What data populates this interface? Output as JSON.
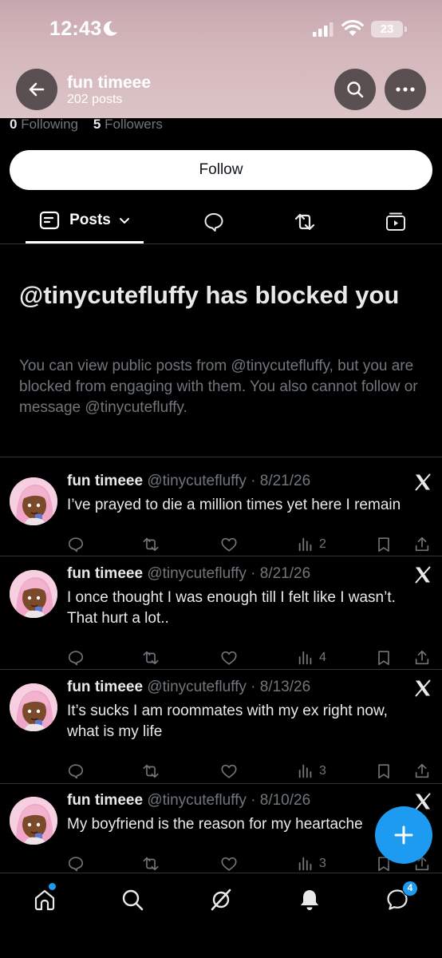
{
  "status_bar": {
    "time": "12:43",
    "battery": "23"
  },
  "header": {
    "name": "fun timeee",
    "posts_count": "202 posts"
  },
  "profile": {
    "following_count": "0",
    "following_label": "Following",
    "followers_count": "5",
    "followers_label": "Followers",
    "follow_button": "Follow"
  },
  "tabs": {
    "active_label": "Posts"
  },
  "blocked": {
    "title": "@tinycutefluffy has blocked you",
    "body": "You can view public posts from @tinycutefluffy, but you are blocked from engaging with them. You also cannot follow or message @tinycutefluffy."
  },
  "posts": [
    {
      "name": "fun timeee",
      "meta": "@tinycutefluffy · 8/21/26",
      "lines": [
        "I’ve prayed to die a million times yet here I remain"
      ],
      "views": "2"
    },
    {
      "name": "fun timeee",
      "meta": "@tinycutefluffy · 8/21/26",
      "lines": [
        "I once thought I was enough till I felt like I wasn’t.",
        "That hurt a lot.."
      ],
      "views": "4"
    },
    {
      "name": "fun timeee",
      "meta": "@tinycutefluffy · 8/13/26",
      "lines": [
        "It’s sucks I am roommates with my ex right now,",
        "what is my life"
      ],
      "views": "3"
    },
    {
      "name": "fun timeee",
      "meta": "@tinycutefluffy · 8/10/26",
      "lines": [
        "My boyfriend is the reason for my heartache"
      ],
      "views": "3"
    }
  ],
  "nav": {
    "messages_badge": "4"
  },
  "colors": {
    "accent": "#1d9bf0",
    "muted": "#71767b",
    "divider": "#2f3336"
  },
  "icons": [
    "back-arrow-icon",
    "search-icon",
    "more-icon",
    "posts-tab-icon",
    "chevron-down-icon",
    "reply-icon",
    "repost-icon",
    "media-icon",
    "x-logo-icon",
    "like-icon",
    "views-icon",
    "bookmark-icon",
    "share-icon",
    "compose-plus-icon",
    "home-icon",
    "grok-icon",
    "bell-icon",
    "messages-icon"
  ]
}
